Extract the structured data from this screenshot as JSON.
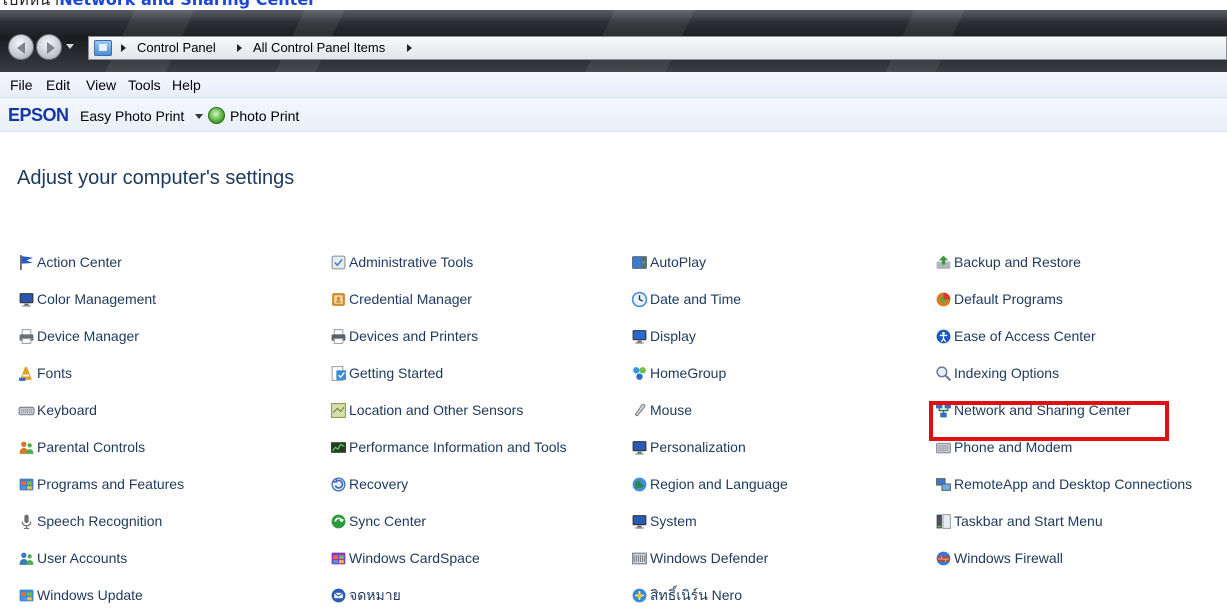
{
  "caption": {
    "prefix": "ไปที่หน้า",
    "link": "Network and Sharing Center"
  },
  "address_bar": {
    "crumbs": [
      "Control Panel",
      "All Control Panel Items"
    ]
  },
  "menu": [
    "File",
    "Edit",
    "View",
    "Tools",
    "Help"
  ],
  "toolbar": {
    "brand": "EPSON",
    "easy_photo_print": "Easy Photo Print",
    "photo_print": "Photo Print"
  },
  "page_title": "Adjust your computer's settings",
  "items": [
    {
      "label": "Action Center",
      "icon": "flag-icon",
      "color": "#2a5bbf"
    },
    {
      "label": "Administrative Tools",
      "icon": "admin-tools-icon",
      "color": "#8a8f96"
    },
    {
      "label": "AutoPlay",
      "icon": "autoplay-icon",
      "color": "#3a7bd0"
    },
    {
      "label": "Backup and Restore",
      "icon": "backup-icon",
      "color": "#3a9a3a"
    },
    {
      "label": "Color Management",
      "icon": "monitor-color-icon",
      "color": "#2a56b0"
    },
    {
      "label": "Credential Manager",
      "icon": "credential-icon",
      "color": "#d08a2a"
    },
    {
      "label": "Date and Time",
      "icon": "clock-icon",
      "color": "#4a8cd8"
    },
    {
      "label": "Default Programs",
      "icon": "default-programs-icon",
      "color": "#e07a1a"
    },
    {
      "label": "Device Manager",
      "icon": "device-manager-icon",
      "color": "#6a7078"
    },
    {
      "label": "Devices and Printers",
      "icon": "printer-icon",
      "color": "#5a6068"
    },
    {
      "label": "Display",
      "icon": "display-icon",
      "color": "#2a6ad0"
    },
    {
      "label": "Ease of Access Center",
      "icon": "ease-of-access-icon",
      "color": "#1a5ac0"
    },
    {
      "label": "Fonts",
      "icon": "fonts-icon",
      "color": "#e0a020"
    },
    {
      "label": "Getting Started",
      "icon": "getting-started-icon",
      "color": "#3a8ad8"
    },
    {
      "label": "HomeGroup",
      "icon": "homegroup-icon",
      "color": "#2a70c8"
    },
    {
      "label": "Indexing Options",
      "icon": "indexing-icon",
      "color": "#6a7a9a"
    },
    {
      "label": "Keyboard",
      "icon": "keyboard-icon",
      "color": "#7a7f86"
    },
    {
      "label": "Location and Other Sensors",
      "icon": "location-icon",
      "color": "#8a9a4a"
    },
    {
      "label": "Mouse",
      "icon": "mouse-icon",
      "color": "#6a6f76"
    },
    {
      "label": "Network and Sharing Center",
      "icon": "network-icon",
      "color": "#2a7a3a"
    },
    {
      "label": "Parental Controls",
      "icon": "parental-controls-icon",
      "color": "#d07a2a"
    },
    {
      "label": "Performance Information and Tools",
      "icon": "performance-icon",
      "color": "#2a3a2a"
    },
    {
      "label": "Personalization",
      "icon": "personalization-icon",
      "color": "#2a5ab8"
    },
    {
      "label": "Phone and Modem",
      "icon": "phone-modem-icon",
      "color": "#8a8f96"
    },
    {
      "label": "Programs and Features",
      "icon": "programs-icon",
      "color": "#4a7ac0"
    },
    {
      "label": "Recovery",
      "icon": "recovery-icon",
      "color": "#3a6ab8"
    },
    {
      "label": "Region and Language",
      "icon": "globe-icon",
      "color": "#2a8a4a"
    },
    {
      "label": "RemoteApp and Desktop Connections",
      "icon": "remoteapp-icon",
      "color": "#3a7ac8"
    },
    {
      "label": "Speech Recognition",
      "icon": "microphone-icon",
      "color": "#6a6f76"
    },
    {
      "label": "Sync Center",
      "icon": "sync-icon",
      "color": "#2a9a3a"
    },
    {
      "label": "System",
      "icon": "system-icon",
      "color": "#2a5ab8"
    },
    {
      "label": "Taskbar and Start Menu",
      "icon": "taskbar-icon",
      "color": "#4a4f56"
    },
    {
      "label": "User Accounts",
      "icon": "user-accounts-icon",
      "color": "#3a7ac0"
    },
    {
      "label": "Windows CardSpace",
      "icon": "cardspace-icon",
      "color": "#8a3ab8"
    },
    {
      "label": "Windows Defender",
      "icon": "defender-icon",
      "color": "#7a7f86"
    },
    {
      "label": "Windows Firewall",
      "icon": "firewall-icon",
      "color": "#b84a2a"
    },
    {
      "label": "Windows Update",
      "icon": "windows-update-icon",
      "color": "#3a8ad0"
    },
    {
      "label": "จดหมาย",
      "icon": "mail-icon",
      "color": "#2a5ab8"
    },
    {
      "label": "สิทธิ์เนิร์น Nero",
      "icon": "nero-icon",
      "color": "#3a8ad0"
    }
  ],
  "highlighted_item": "Network and Sharing Center",
  "highlight_color": "#e01010"
}
